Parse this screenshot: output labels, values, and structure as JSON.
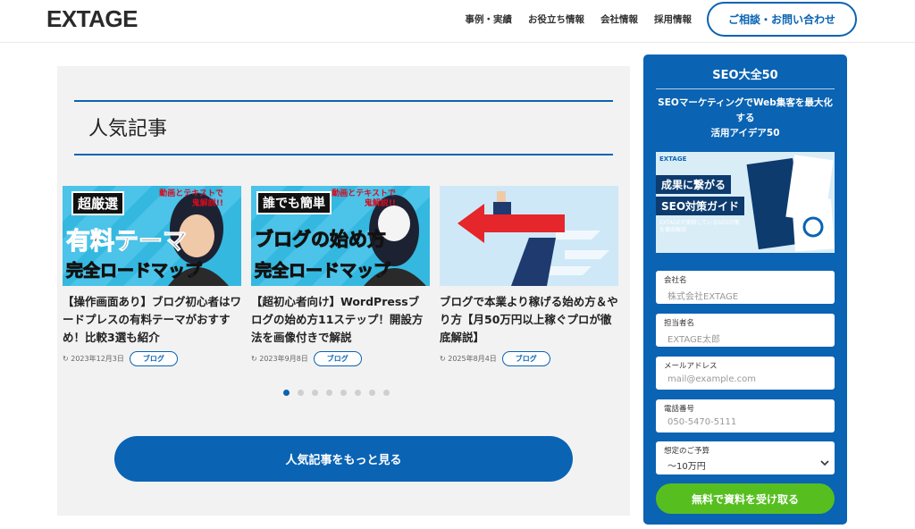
{
  "header": {
    "logo": "EXTAGE",
    "nav": [
      "事例・実績",
      "お役立ち情報",
      "会社情報",
      "採用情報"
    ],
    "cta": "ご相談・お問い合わせ"
  },
  "popular": {
    "title": "人気記事",
    "cards": [
      {
        "thumb_top": "超厳選",
        "thumb_badge": "動画とテキストで鬼解説!!",
        "thumb_main": "有料テーマ",
        "thumb_bottom": "完全ロードマップ",
        "title": "【操作画面あり】ブログ初心者はワードプレスの有料テーマがおすすめ！比較3選も紹介",
        "date": "2023年12月3日",
        "tag": "ブログ"
      },
      {
        "thumb_top": "誰でも簡単",
        "thumb_badge": "動画とテキストで鬼解説!!",
        "thumb_main": "ブログの始め方",
        "thumb_bottom": "完全ロードマップ",
        "title": "【超初心者向け】WordPressブログの始め方11ステップ！開設方法を画像付きで解説",
        "date": "2023年9月8日",
        "tag": "ブログ"
      },
      {
        "title": "ブログで本業より稼げる始め方＆やり方【月50万円以上稼ぐプロが徹底解説】",
        "date": "2025年8月4日",
        "tag": "ブログ"
      }
    ],
    "more_button": "人気記事をもっと見る"
  },
  "sidebar": {
    "title": "SEO大全50",
    "subtitle_line1": "SEOマーケティングでWeb集客を最大化",
    "subtitle_line2": "する",
    "subtitle_line3": "活用アイデア50",
    "guide_logo": "EXTAGE",
    "guide_line1": "成果に繋がる",
    "guide_line2": "SEO対策ガイド",
    "guide_small": "EXTAGEが実践しているSEO対策を徹底解説",
    "fields": [
      {
        "label": "会社名",
        "placeholder": "株式会社EXTAGE"
      },
      {
        "label": "担当者名",
        "placeholder": "EXTAGE太郎"
      },
      {
        "label": "メールアドレス",
        "placeholder": "mail@example.com"
      },
      {
        "label": "電話番号",
        "placeholder": "050-5470-5111"
      },
      {
        "label": "想定のご予算",
        "value": "～10万円"
      }
    ],
    "submit": "無料で資料を受け取る"
  },
  "colors": {
    "brand": "#0a63b3",
    "submit": "#56bf1f",
    "panel": "#f2f2f2"
  }
}
